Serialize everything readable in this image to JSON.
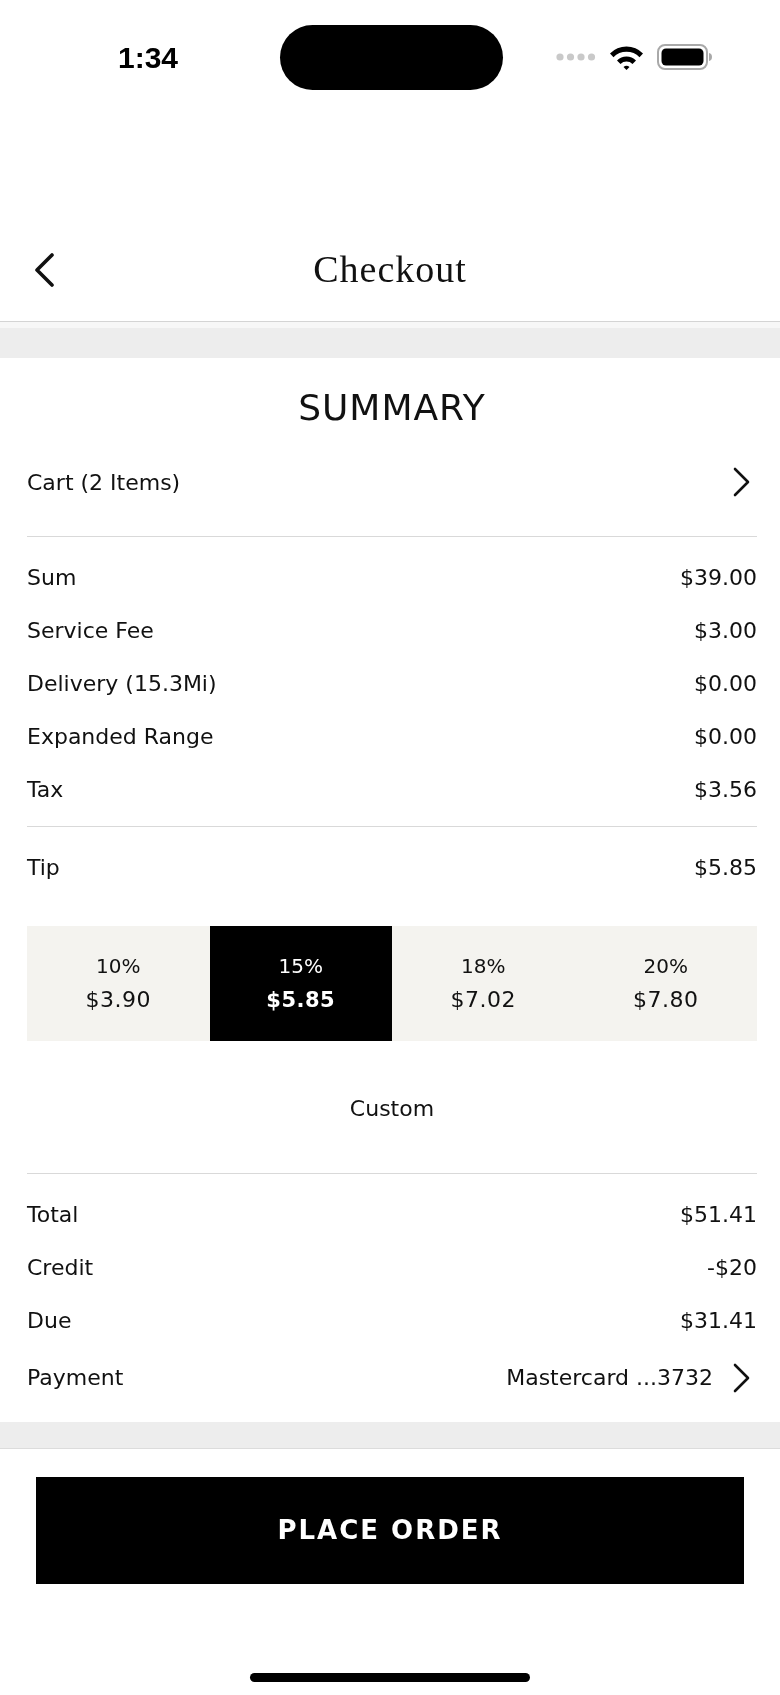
{
  "status_bar": {
    "time": "1:34"
  },
  "header": {
    "title": "Checkout"
  },
  "summary": {
    "title": "SUMMARY",
    "cart": {
      "label": "Cart (2 Items)"
    },
    "charges": [
      {
        "label": "Sum",
        "value": "$39.00"
      },
      {
        "label": "Service Fee",
        "value": "$3.00"
      },
      {
        "label": "Delivery (15.3Mi)",
        "value": "$0.00"
      },
      {
        "label": "Expanded Range",
        "value": "$0.00"
      },
      {
        "label": "Tax",
        "value": "$3.56"
      }
    ],
    "tip": {
      "label": "Tip",
      "value": "$5.85",
      "options": [
        {
          "percent": "10%",
          "amount": "$3.90",
          "selected": false
        },
        {
          "percent": "15%",
          "amount": "$5.85",
          "selected": true
        },
        {
          "percent": "18%",
          "amount": "$7.02",
          "selected": false
        },
        {
          "percent": "20%",
          "amount": "$7.80",
          "selected": false
        }
      ],
      "custom": "Custom"
    },
    "totals": [
      {
        "label": "Total",
        "value": "$51.41"
      },
      {
        "label": "Credit",
        "value": "-$20"
      },
      {
        "label": "Due",
        "value": "$31.41"
      }
    ],
    "payment": {
      "label": "Payment",
      "value": "Mastercard ...3732"
    }
  },
  "place_order": {
    "label": "PLACE ORDER"
  }
}
